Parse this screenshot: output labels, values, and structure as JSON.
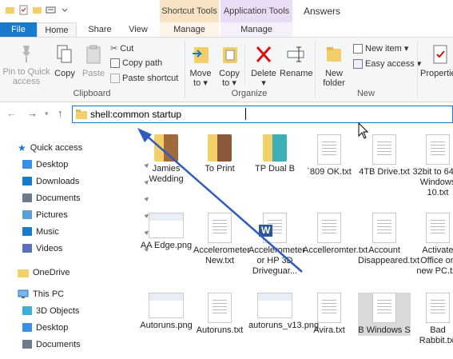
{
  "window": {
    "title": "Answers"
  },
  "context_tabs": {
    "shortcut_tools": "Shortcut Tools",
    "application_tools": "Application Tools"
  },
  "tabs": {
    "file": "File",
    "home": "Home",
    "share": "Share",
    "view": "View",
    "manage1": "Manage",
    "manage2": "Manage"
  },
  "ribbon": {
    "pin_quick_access": "Pin to Quick access",
    "copy": "Copy",
    "paste": "Paste",
    "cut": "Cut",
    "copy_path": "Copy path",
    "paste_shortcut": "Paste shortcut",
    "clipboard_group": "Clipboard",
    "move_to": "Move to",
    "copy_to": "Copy to",
    "delete": "Delete",
    "rename": "Rename",
    "organize_group": "Organize",
    "new_folder": "New folder",
    "new_item": "New item",
    "easy_access": "Easy access",
    "new_group": "New",
    "properties": "Properties"
  },
  "address": {
    "value": "shell:common startup"
  },
  "sidebar": {
    "quick_access": "Quick access",
    "items": [
      {
        "label": "Desktop",
        "icon": "desktop-icon"
      },
      {
        "label": "Downloads",
        "icon": "downloads-icon"
      },
      {
        "label": "Documents",
        "icon": "documents-icon"
      },
      {
        "label": "Pictures",
        "icon": "pictures-icon"
      },
      {
        "label": "Music",
        "icon": "music-icon"
      },
      {
        "label": "Videos",
        "icon": "videos-icon"
      }
    ],
    "onedrive": "OneDrive",
    "this_pc": "This PC",
    "pc_items": [
      {
        "label": "3D Objects",
        "icon": "3d-objects-icon"
      },
      {
        "label": "Desktop",
        "icon": "desktop-icon"
      },
      {
        "label": "Documents",
        "icon": "documents-icon"
      }
    ]
  },
  "files": [
    {
      "name": "Jamies Wedding",
      "type": "folder-photo"
    },
    {
      "name": "To Print",
      "type": "folder"
    },
    {
      "name": "TP Dual B",
      "type": "folder-app"
    },
    {
      "name": "`809 OK.txt",
      "type": "doc"
    },
    {
      "name": "4TB Drive.txt",
      "type": "doc"
    },
    {
      "name": "32bit to 64bit Windows 10.txt",
      "type": "doc"
    },
    {
      "name": "AA Edge.png",
      "type": "png"
    },
    {
      "name": "Accelerometer New.txt",
      "type": "doc"
    },
    {
      "name": "Accelerometer or HP 3D Driveguar...",
      "type": "word"
    },
    {
      "name": "Accelleromter.txt",
      "type": "doc"
    },
    {
      "name": "Account Disappeared.txt",
      "type": "doc"
    },
    {
      "name": "Activate Office on new PC.txt",
      "type": "doc"
    },
    {
      "name": "Autoruns.png",
      "type": "png"
    },
    {
      "name": "Autoruns.txt",
      "type": "doc"
    },
    {
      "name": "autoruns_v13.png",
      "type": "png"
    },
    {
      "name": "Avira.txt",
      "type": "doc"
    },
    {
      "name": "B Windows S",
      "type": "doc"
    },
    {
      "name": "Bad Rabbit.txt",
      "type": "doc"
    }
  ]
}
